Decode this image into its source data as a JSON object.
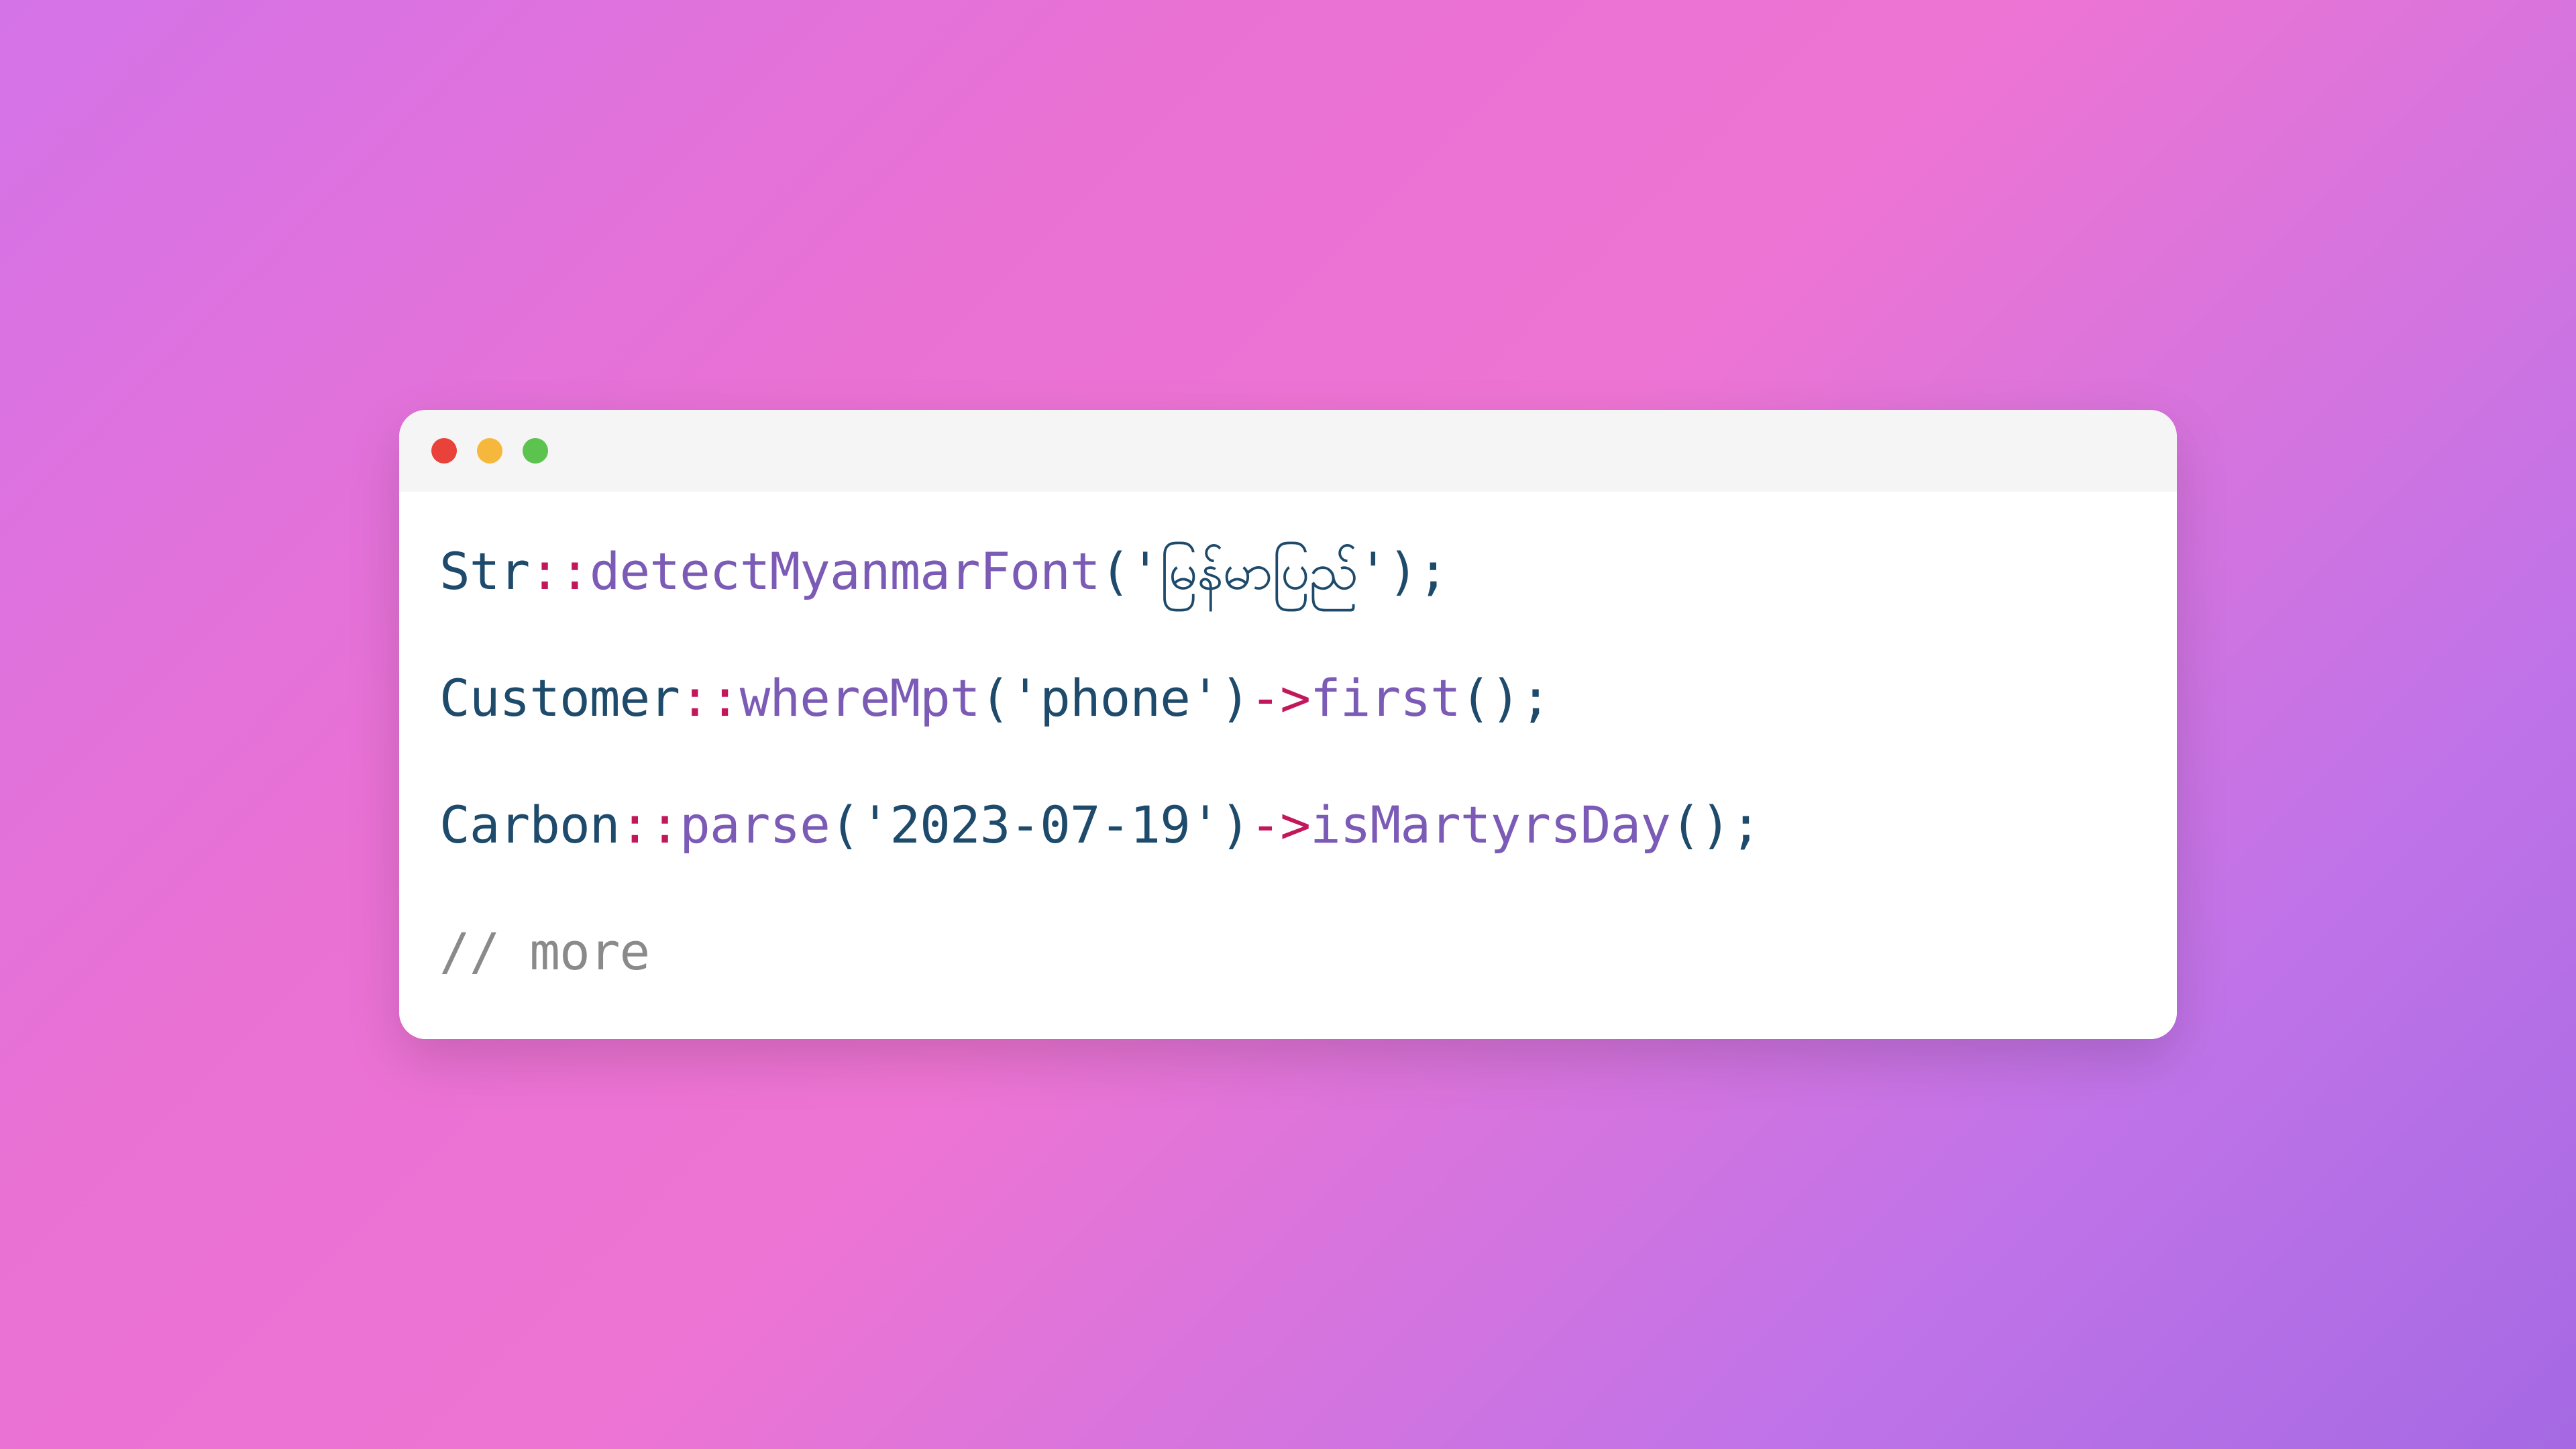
{
  "lines": [
    {
      "tokens": [
        {
          "class": "tok-class",
          "text": "Str"
        },
        {
          "class": "tok-scope",
          "text": "::"
        },
        {
          "class": "tok-method",
          "text": "detectMyanmarFont"
        },
        {
          "class": "tok-paren",
          "text": "("
        },
        {
          "class": "tok-string",
          "text": "'မြန်မာပြည်'"
        },
        {
          "class": "tok-paren",
          "text": ")"
        },
        {
          "class": "tok-semi",
          "text": ";"
        }
      ]
    },
    {
      "tokens": [
        {
          "class": "tok-class",
          "text": "Customer"
        },
        {
          "class": "tok-scope",
          "text": "::"
        },
        {
          "class": "tok-method",
          "text": "whereMpt"
        },
        {
          "class": "tok-paren",
          "text": "("
        },
        {
          "class": "tok-string",
          "text": "'phone'"
        },
        {
          "class": "tok-paren",
          "text": ")"
        },
        {
          "class": "tok-arrow",
          "text": "->"
        },
        {
          "class": "tok-method",
          "text": "first"
        },
        {
          "class": "tok-paren",
          "text": "()"
        },
        {
          "class": "tok-semi",
          "text": ";"
        }
      ]
    },
    {
      "tokens": [
        {
          "class": "tok-class",
          "text": "Carbon"
        },
        {
          "class": "tok-scope",
          "text": "::"
        },
        {
          "class": "tok-method",
          "text": "parse"
        },
        {
          "class": "tok-paren",
          "text": "("
        },
        {
          "class": "tok-string",
          "text": "'2023-07-19'"
        },
        {
          "class": "tok-paren",
          "text": ")"
        },
        {
          "class": "tok-arrow",
          "text": "->"
        },
        {
          "class": "tok-method",
          "text": "isMartyrsDay"
        },
        {
          "class": "tok-paren",
          "text": "()"
        },
        {
          "class": "tok-semi",
          "text": ";"
        }
      ]
    },
    {
      "tokens": [
        {
          "class": "tok-comment",
          "text": "// more"
        }
      ]
    }
  ]
}
